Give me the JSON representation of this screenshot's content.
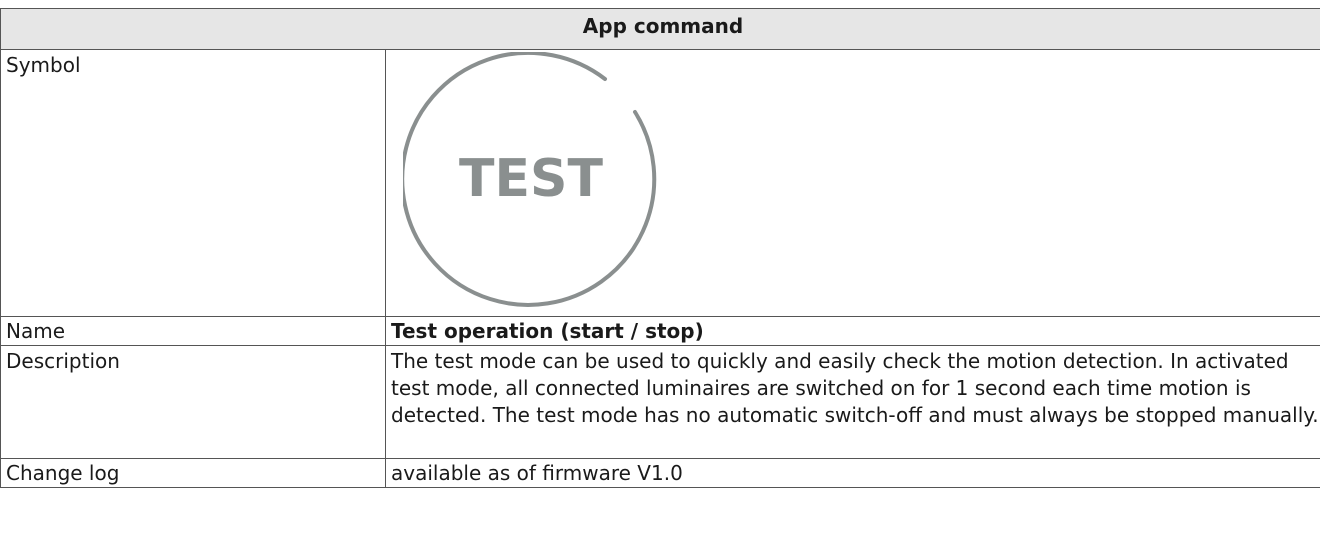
{
  "table": {
    "header": "App command",
    "rows": {
      "symbol": {
        "label": "Symbol",
        "icon": "test-mode-icon",
        "icon_text": "TEST",
        "icon_color": "#8a8f8f"
      },
      "name": {
        "label": "Name",
        "value": "Test operation (start / stop)"
      },
      "description": {
        "label": "Description",
        "value": "The test mode can be used to quickly and easily check the motion detection. In activated test mode, all connected luminaires are switched on for 1 second each time motion is detected. The test mode has no automatic switch-off and must always be stopped manually."
      },
      "changelog": {
        "label": "Change log",
        "value": "available as of firmware V1.0"
      }
    }
  }
}
